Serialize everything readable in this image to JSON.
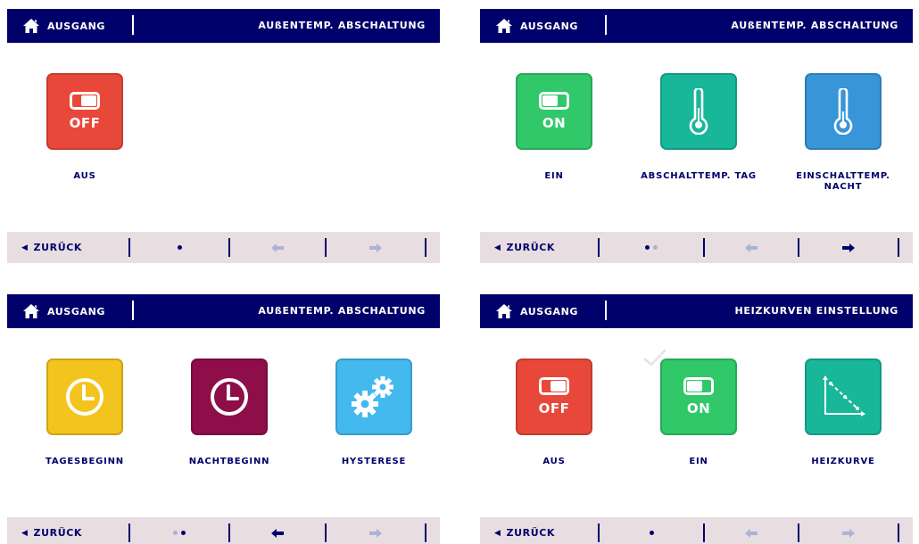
{
  "colors": {
    "header_bg": "#00006b",
    "footer_bg": "#e8dde1",
    "label": "#00006b",
    "red": "#e8483a",
    "green": "#31c86a",
    "teal": "#19b79a",
    "blue": "#3895d8",
    "yellow": "#f2c41d",
    "maroon": "#8e0e49",
    "cyan": "#44b9ee",
    "arrow_dim": "#aab2d8"
  },
  "panels": [
    {
      "home_label": "AUSGANG",
      "home_icon": "home-icon",
      "title": "AUßENTEMP. ABSCHALTUNG",
      "tiles": [
        {
          "icon": "toggle-off-icon",
          "icon_text": "OFF",
          "label": "AUS",
          "color": "red"
        }
      ],
      "footer": {
        "back_label": "ZURÜCK",
        "page_dots": 1,
        "active_dot": 1,
        "prev_enabled": false,
        "next_enabled": false
      }
    },
    {
      "home_label": "AUSGANG",
      "home_icon": "home-icon",
      "title": "AUßENTEMP. ABSCHALTUNG",
      "tiles": [
        {
          "icon": "toggle-on-icon",
          "icon_text": "ON",
          "label": "EIN",
          "color": "green"
        },
        {
          "icon": "thermometer-icon",
          "label": "ABSCHALTTEMP. TAG",
          "color": "teal"
        },
        {
          "icon": "thermometer-icon",
          "label": "EINSCHALTTEMP. NACHT",
          "color": "blue"
        }
      ],
      "footer": {
        "back_label": "ZURÜCK",
        "page_dots": 2,
        "active_dot": 1,
        "prev_enabled": false,
        "next_enabled": true
      }
    },
    {
      "home_label": "AUSGANG",
      "home_icon": "home-icon",
      "title": "AUßENTEMP. ABSCHALTUNG",
      "tiles": [
        {
          "icon": "clock-icon",
          "label": "TAGESBEGINN",
          "color": "yellow"
        },
        {
          "icon": "clock-icon",
          "label": "NACHTBEGINN",
          "color": "maroon"
        },
        {
          "icon": "gears-icon",
          "label": "HYSTERESE",
          "color": "cyan"
        }
      ],
      "footer": {
        "back_label": "ZURÜCK",
        "page_dots": 2,
        "active_dot": 2,
        "prev_enabled": true,
        "next_enabled": false
      }
    },
    {
      "home_label": "AUSGANG",
      "home_icon": "home-icon",
      "title": "HEIZKURVEN EINSTELLUNG",
      "tiles": [
        {
          "icon": "toggle-off-icon",
          "icon_text": "OFF",
          "label": "AUS",
          "color": "red"
        },
        {
          "icon": "toggle-on-icon",
          "icon_text": "ON",
          "label": "EIN",
          "color": "green"
        },
        {
          "icon": "heating-curve-icon",
          "label": "HEIZKURVE",
          "color": "teal"
        }
      ],
      "footer": {
        "back_label": "ZURÜCK",
        "page_dots": 1,
        "active_dot": 1,
        "prev_enabled": false,
        "next_enabled": false
      }
    }
  ]
}
